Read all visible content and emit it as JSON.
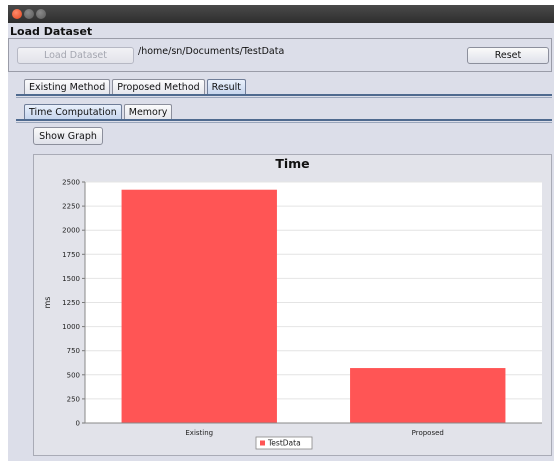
{
  "load_panel": {
    "title": "Load Dataset",
    "load_button_label": "Load Dataset",
    "path": "/home/sn/Documents/TestData",
    "reset_button_label": "Reset"
  },
  "main_tabs": [
    {
      "label": "Existing Method",
      "active": false
    },
    {
      "label": "Proposed Method",
      "active": false
    },
    {
      "label": "Result",
      "active": true
    }
  ],
  "sub_tabs": [
    {
      "label": "Time Computation",
      "active": true
    },
    {
      "label": "Memory",
      "active": false
    }
  ],
  "show_graph_label": "Show Graph",
  "colors": {
    "bar": "#ff5555",
    "accent": "#4f6a8f"
  },
  "chart_data": {
    "type": "bar",
    "title": "Time",
    "xlabel": "",
    "ylabel": "ms",
    "categories": [
      "Existing",
      "Proposed"
    ],
    "series": [
      {
        "name": "TestData",
        "values": [
          2420,
          570
        ]
      }
    ],
    "ylim": [
      0,
      2500
    ],
    "yticks": [
      0,
      250,
      500,
      750,
      1000,
      1250,
      1500,
      1750,
      2000,
      2250,
      2500
    ],
    "legend": "bottom"
  }
}
